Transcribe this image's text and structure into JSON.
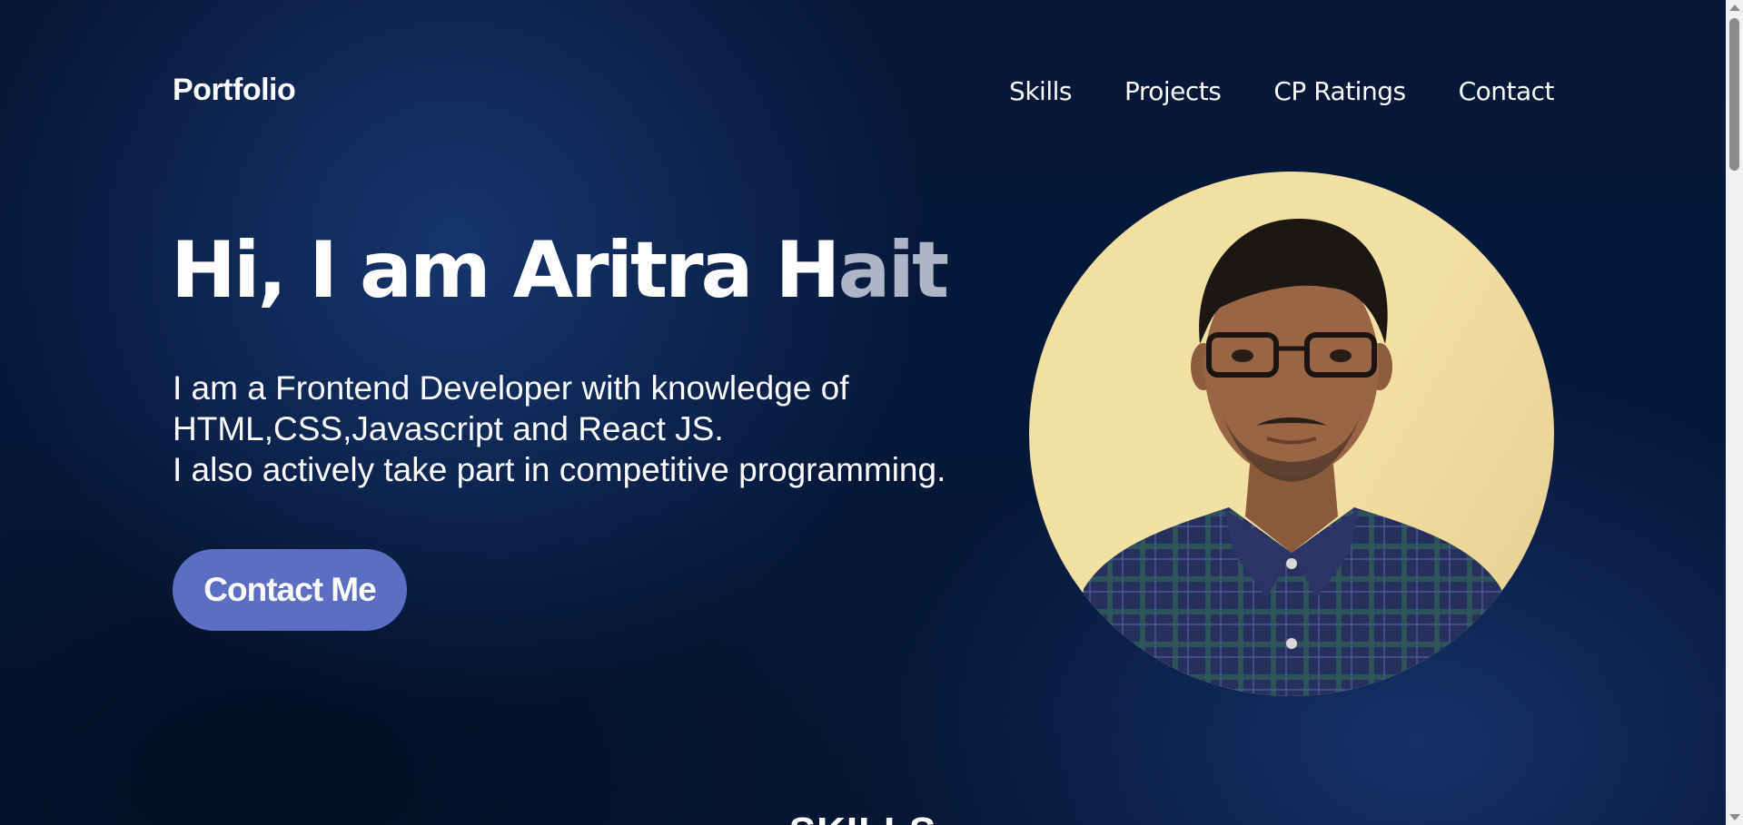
{
  "header": {
    "brand": "Portfolio",
    "nav": [
      {
        "label": "Skills"
      },
      {
        "label": "Projects"
      },
      {
        "label": "CP Ratings"
      },
      {
        "label": "Contact"
      }
    ]
  },
  "hero": {
    "title_main": "Hi, I am Aritra H",
    "title_faded": "ait",
    "description": [
      "I am a Frontend Developer with knowledge of",
      "HTML,CSS,Javascript and React JS.",
      "I also actively take part in competitive programming."
    ],
    "cta_label": "Contact Me"
  },
  "next_section": {
    "heading": "SKILLS"
  },
  "colors": {
    "background": "#071737",
    "button": "#5b6ec2",
    "avatar_bg": "#f1e0a2",
    "title_faded": "#aeb5c6"
  },
  "scrollbar": {
    "position_fraction": 0.0
  }
}
